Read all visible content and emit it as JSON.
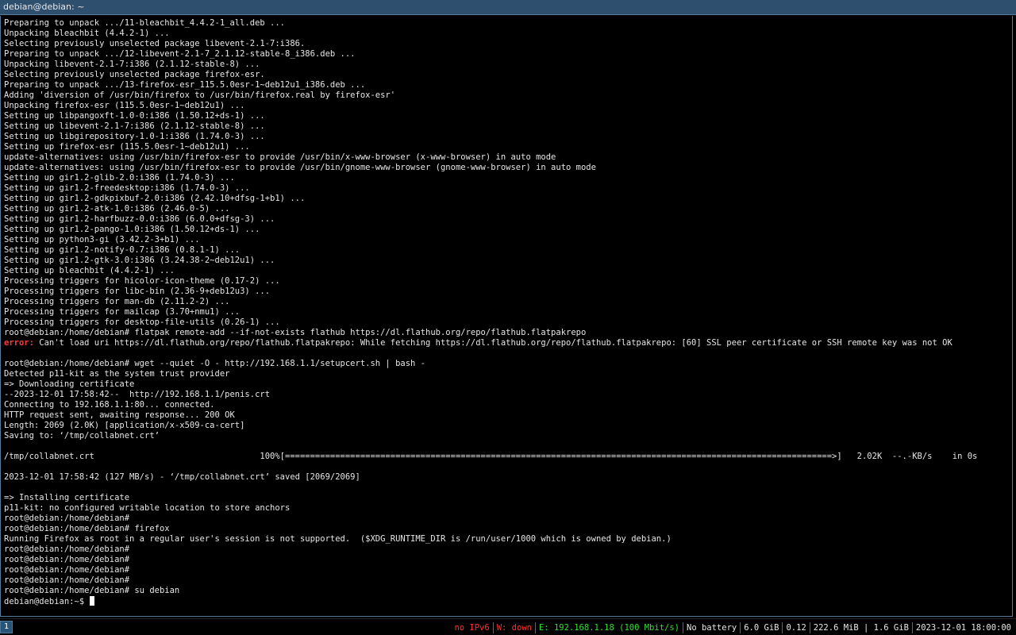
{
  "window": {
    "title": "debian@debian: ~"
  },
  "terminal": {
    "lines": [
      "Preparing to unpack .../11-bleachbit_4.4.2-1_all.deb ...",
      "Unpacking bleachbit (4.4.2-1) ...",
      "Selecting previously unselected package libevent-2.1-7:i386.",
      "Preparing to unpack .../12-libevent-2.1-7_2.1.12-stable-8_i386.deb ...",
      "Unpacking libevent-2.1-7:i386 (2.1.12-stable-8) ...",
      "Selecting previously unselected package firefox-esr.",
      "Preparing to unpack .../13-firefox-esr_115.5.0esr-1~deb12u1_i386.deb ...",
      "Adding 'diversion of /usr/bin/firefox to /usr/bin/firefox.real by firefox-esr'",
      "Unpacking firefox-esr (115.5.0esr-1~deb12u1) ...",
      "Setting up libpangoxft-1.0-0:i386 (1.50.12+ds-1) ...",
      "Setting up libevent-2.1-7:i386 (2.1.12-stable-8) ...",
      "Setting up libgirepository-1.0-1:i386 (1.74.0-3) ...",
      "Setting up firefox-esr (115.5.0esr-1~deb12u1) ...",
      "update-alternatives: using /usr/bin/firefox-esr to provide /usr/bin/x-www-browser (x-www-browser) in auto mode",
      "update-alternatives: using /usr/bin/firefox-esr to provide /usr/bin/gnome-www-browser (gnome-www-browser) in auto mode",
      "Setting up gir1.2-glib-2.0:i386 (1.74.0-3) ...",
      "Setting up gir1.2-freedesktop:i386 (1.74.0-3) ...",
      "Setting up gir1.2-gdkpixbuf-2.0:i386 (2.42.10+dfsg-1+b1) ...",
      "Setting up gir1.2-atk-1.0:i386 (2.46.0-5) ...",
      "Setting up gir1.2-harfbuzz-0.0:i386 (6.0.0+dfsg-3) ...",
      "Setting up gir1.2-pango-1.0:i386 (1.50.12+ds-1) ...",
      "Setting up python3-gi (3.42.2-3+b1) ...",
      "Setting up gir1.2-notify-0.7:i386 (0.8.1-1) ...",
      "Setting up gir1.2-gtk-3.0:i386 (3.24.38-2~deb12u1) ...",
      "Setting up bleachbit (4.4.2-1) ...",
      "Processing triggers for hicolor-icon-theme (0.17-2) ...",
      "Processing triggers for libc-bin (2.36-9+deb12u3) ...",
      "Processing triggers for man-db (2.11.2-2) ...",
      "Processing triggers for mailcap (3.70+nmu1) ...",
      "Processing triggers for desktop-file-utils (0.26-1) ...",
      "root@debian:/home/debian# flatpak remote-add --if-not-exists flathub https://dl.flathub.org/repo/flathub.flatpakrepo",
      "",
      "",
      "root@debian:/home/debian# wget --quiet -O - http://192.168.1.1/setupcert.sh | bash -",
      "Detected p11-kit as the system trust provider",
      "=> Downloading certificate",
      "--2023-12-01 17:58:42--  http://192.168.1.1/penis.crt",
      "Connecting to 192.168.1.1:80... connected.",
      "HTTP request sent, awaiting response... 200 OK",
      "Length: 2069 (2.0K) [application/x-x509-ca-cert]",
      "Saving to: ‘/tmp/collabnet.crt’",
      "",
      "/tmp/collabnet.crt                                 100%[=============================================================================================================>]   2.02K  --.-KB/s    in 0s",
      "",
      "2023-12-01 17:58:42 (127 MB/s) - ‘/tmp/collabnet.crt’ saved [2069/2069]",
      "",
      "=> Installing certificate",
      "p11-kit: no configured writable location to store anchors",
      "root@debian:/home/debian#",
      "root@debian:/home/debian# firefox",
      "Running Firefox as root in a regular user's session is not supported.  ($XDG_RUNTIME_DIR is /run/user/1000 which is owned by debian.)",
      "root@debian:/home/debian#",
      "root@debian:/home/debian#",
      "root@debian:/home/debian#",
      "root@debian:/home/debian#",
      "root@debian:/home/debian# su debian",
      "debian@debian:~$ "
    ],
    "error_line": {
      "label": "error:",
      "text": " Can't load uri https://dl.flathub.org/repo/flathub.flatpakrepo: While fetching https://dl.flathub.org/repo/flathub.flatpakrepo: [60] SSL peer certificate or SSH remote key was not OK"
    }
  },
  "statusbar": {
    "workspace": "1",
    "items": [
      {
        "name": "ipv6-status",
        "text": "no IPv6",
        "color": "#ff3030"
      },
      {
        "name": "wireless-status",
        "text": "W: down",
        "color": "#ff3030"
      },
      {
        "name": "ethernet-status",
        "text": "E: 192.168.1.18 (100 Mbit/s)",
        "color": "#30e030"
      },
      {
        "name": "battery-status",
        "text": "No battery",
        "color": "#e6e6e6"
      },
      {
        "name": "disk-status",
        "text": "6.0 GiB",
        "color": "#e6e6e6"
      },
      {
        "name": "load-status",
        "text": "0.12",
        "color": "#e6e6e6"
      },
      {
        "name": "memory-status",
        "text": "222.6 MiB | 1.6 GiB",
        "color": "#e6e6e6"
      },
      {
        "name": "clock",
        "text": "2023-12-01 18:00:00",
        "color": "#e6e6e6"
      }
    ]
  },
  "colors": {
    "background": "#000000",
    "foreground": "#e6e6e6",
    "error": "#ff3b3b",
    "titlebar": "#2f4f6f",
    "workspace_active": "#285577"
  }
}
